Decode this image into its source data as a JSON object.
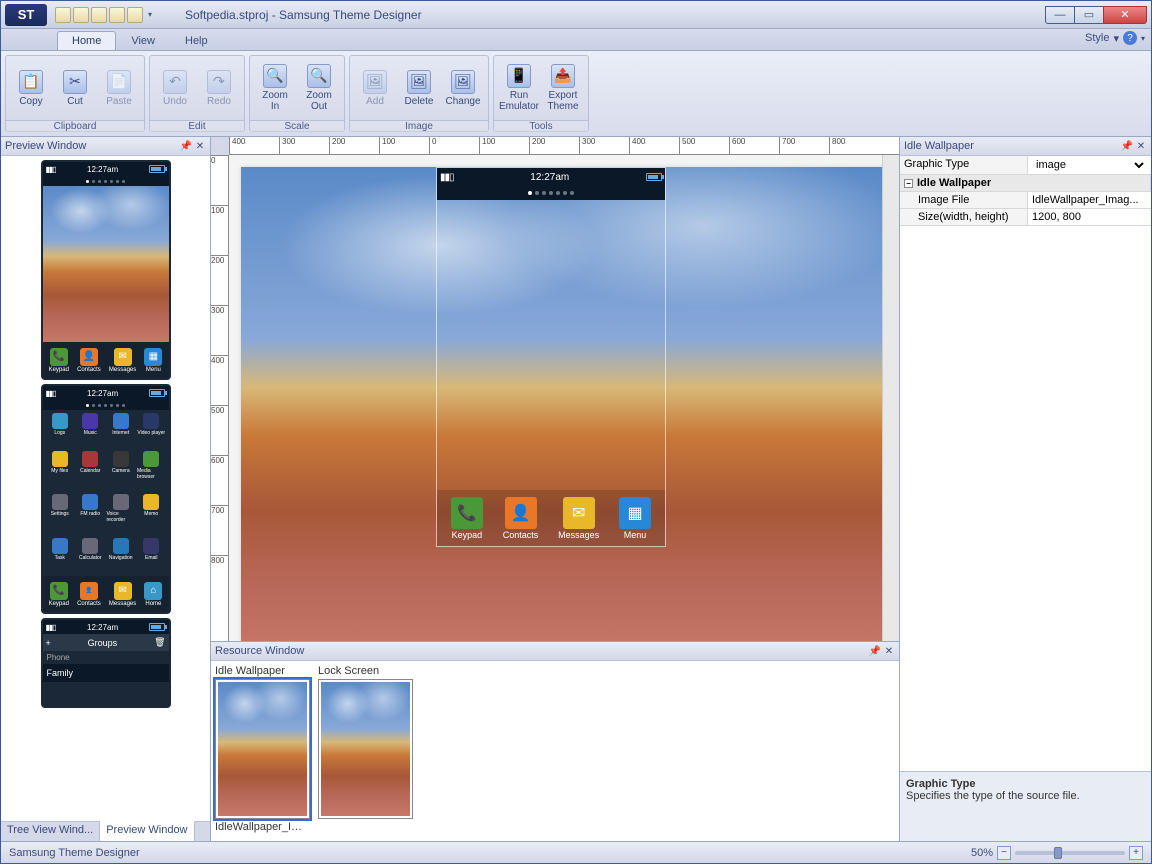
{
  "title": "Softpedia.stproj - Samsung Theme Designer",
  "app_icon_text": "ST",
  "menu": {
    "home": "Home",
    "view": "View",
    "help": "Help",
    "style": "Style"
  },
  "ribbon": {
    "clipboard": {
      "label": "Clipboard",
      "copy": "Copy",
      "cut": "Cut",
      "paste": "Paste"
    },
    "edit": {
      "label": "Edit",
      "undo": "Undo",
      "redo": "Redo"
    },
    "scale": {
      "label": "Scale",
      "zoom_in": "Zoom\nIn",
      "zoom_out": "Zoom\nOut"
    },
    "image": {
      "label": "Image",
      "add": "Add",
      "delete": "Delete",
      "change": "Change"
    },
    "tools": {
      "label": "Tools",
      "run": "Run\nEmulator",
      "export": "Export\nTheme"
    }
  },
  "panels": {
    "preview": "Preview Window",
    "resource": "Resource Window",
    "idle": "Idle Wallpaper",
    "tree_tab": "Tree View Wind...",
    "preview_tab": "Preview Window"
  },
  "phone": {
    "time": "12:27am",
    "dock": {
      "keypad": "Keypad",
      "contacts": "Contacts",
      "messages": "Messages",
      "menu": "Menu",
      "home": "Home"
    },
    "apps": [
      "Logs",
      "Music",
      "Internet",
      "Video player",
      "My files",
      "Calendar",
      "Camera",
      "Media browser",
      "Settings",
      "FM radio",
      "Voice recorder",
      "Memo",
      "Task",
      "Calculator",
      "Navigation",
      "Email"
    ],
    "groups": "Groups",
    "phone_label": "Phone",
    "family": "Family"
  },
  "resource": {
    "idle_label": "Idle Wallpaper",
    "lock_label": "Lock Screen",
    "filename": "IdleWallpaper_Image.png"
  },
  "props": {
    "graphic_type_k": "Graphic Type",
    "graphic_type_v": "image",
    "cat": "Idle Wallpaper",
    "image_file_k": "Image File",
    "image_file_v": "IdleWallpaper_Imag...",
    "size_k": "Size(width, height)",
    "size_v": "1200, 800",
    "desc_title": "Graphic Type",
    "desc_body": "Specifies the type of the source file."
  },
  "status": {
    "text": "Samsung Theme Designer",
    "zoom": "50%"
  },
  "ruler_h": [
    "400",
    "300",
    "200",
    "100",
    "0",
    "100",
    "200",
    "300",
    "400",
    "500",
    "600",
    "700",
    "800"
  ],
  "ruler_v": [
    "0",
    "100",
    "200",
    "300",
    "400",
    "500",
    "600",
    "700",
    "800"
  ],
  "colors": {
    "keypad": "#4a9838",
    "contacts": "#e87828",
    "messages": "#e8b828",
    "menu": "#2888d8",
    "home": "#3898c8",
    "app_palette": [
      "#3898c8",
      "#4838a8",
      "#3878c8",
      "#283868",
      "#e8b828",
      "#a83838",
      "#383838",
      "#4a9838",
      "#686878",
      "#3878c8",
      "#686878",
      "#e8b828",
      "#3878c8",
      "#686878",
      "#2878b8",
      "#383868"
    ]
  }
}
